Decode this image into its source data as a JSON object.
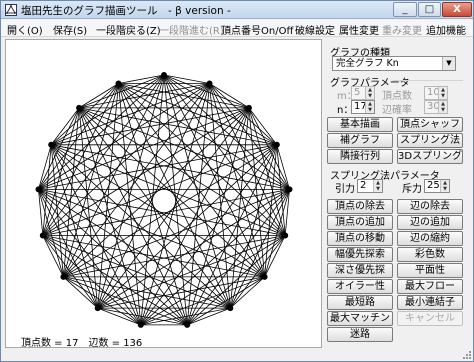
{
  "window": {
    "title": "塩田先生のグラフ描画ツール　- β version -",
    "min_label": "_",
    "max_label": "□",
    "close_label": "X"
  },
  "menu": [
    {
      "label": "開く(O)",
      "enabled": true
    },
    {
      "label": "保存(S)",
      "enabled": true
    },
    {
      "label": "一段階戻る(Z)",
      "enabled": true
    },
    {
      "label": "一段階進む(R)",
      "enabled": false
    },
    {
      "label": "頂点番号On/Off",
      "enabled": true
    },
    {
      "label": "破線設定",
      "enabled": true
    },
    {
      "label": "属性変更",
      "enabled": true
    },
    {
      "label": "重み変更",
      "enabled": false
    },
    {
      "label": "追加機能",
      "enabled": true
    }
  ],
  "graph": {
    "vertex_count": 17,
    "status_text": "頂点数 = 17　辺数 = 136"
  },
  "panel": {
    "graph_type_label": "グラフの種類",
    "graph_type_value": "完全グラフ Kn",
    "graph_params_label": "グラフパラメータ",
    "m_label": "m：",
    "m_value": "5",
    "n_label": "n：",
    "n_value": "17",
    "vertex_count_label": "頂点数",
    "vertex_count_value": "10",
    "edge_prob_label": "辺確率",
    "edge_prob_value": "30",
    "spring_params_label": "スプリング法パラメータ",
    "attraction_label": "引力",
    "attraction_value": "2",
    "repulsion_label": "斥力",
    "repulsion_value": "25"
  },
  "buttons": {
    "basic_draw": "基本描画",
    "vertex_shuffle": "頂点シャッフ",
    "complement": "補グラフ",
    "spring": "スプリング法",
    "adjacency": "隣接行列",
    "spring_3d": "3Dスプリング",
    "remove_vertex": "頂点の除去",
    "remove_edge": "辺の除去",
    "add_vertex": "頂点の追加",
    "add_edge": "辺の追加",
    "move_vertex": "頂点の移動",
    "contract_edge": "辺の縮約",
    "bfs": "幅優先探索",
    "coloring": "彩色数",
    "dfs": "深さ優先探",
    "planarity": "平面性",
    "euler": "オイラー性",
    "max_flow": "最大フロー",
    "shortest_path": "最短路",
    "min_connector": "最小連結子",
    "max_matching": "最大マッチン",
    "cancel": "キャンセル",
    "maze": "迷路"
  }
}
